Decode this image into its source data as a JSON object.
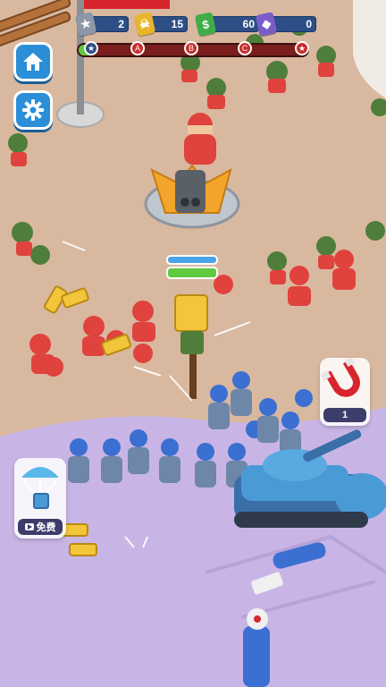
{
  "hud": {
    "resources": [
      {
        "icon": "card-icon",
        "value": "2",
        "color": "#8d97a8"
      },
      {
        "icon": "skull-icon",
        "value": "15",
        "color": "#e8b52a"
      },
      {
        "icon": "cash-icon",
        "value": "60",
        "color": "#3fae4a"
      },
      {
        "icon": "gem-icon",
        "value": "0",
        "color": "#7a5cc9"
      }
    ],
    "wave_progress": 0.06,
    "wave_markers": [
      "★",
      "A",
      "B",
      "C",
      "★"
    ]
  },
  "buttons": {
    "home_icon": "home-icon",
    "settings_icon": "gear-icon",
    "magnet_count": "1",
    "airdrop_label": "免费"
  },
  "colors": {
    "ally": "#3b6fd1",
    "enemy_red": "#e0423d",
    "enemy_green": "#4f7d3a",
    "tank": "#4a9ad6",
    "ground_enemy": "#d9b8a0",
    "ground_ally": "#c8b5e6"
  },
  "turret_hp": {
    "shield": 1.0,
    "health": 1.0
  }
}
